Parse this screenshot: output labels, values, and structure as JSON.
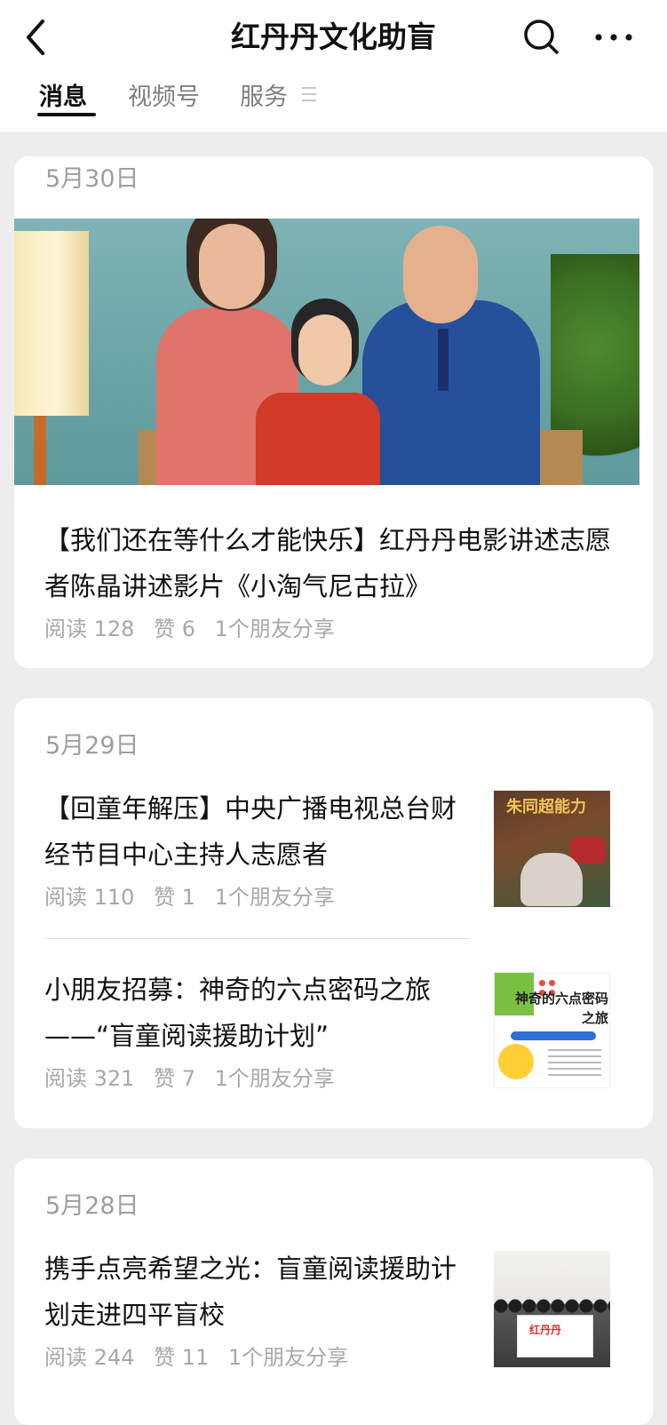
{
  "header": {
    "title": "红丹丹文化助盲",
    "back_icon": "chevron-left-icon",
    "search_icon": "search-icon",
    "more_icon": "more-horizontal-icon"
  },
  "tabs": [
    {
      "label": "消息",
      "active": true
    },
    {
      "label": "视频号",
      "active": false
    },
    {
      "label": "服务",
      "active": false
    }
  ],
  "feed": [
    {
      "date": "5月30日",
      "articles": [
        {
          "title": "【我们还在等什么才能快乐】红丹丹电影讲述志愿者陈晶讲述影片《小淘气尼古拉》",
          "reads": "阅读 128",
          "likes": "赞 6",
          "shares": "1个朋友分享",
          "image": "family-photo"
        }
      ]
    },
    {
      "date": "5月29日",
      "articles": [
        {
          "title": "【回童年解压】中央广播电视总台财经节目中心主持人志愿者",
          "reads": "阅读 110",
          "likes": "赞 1",
          "shares": "1个朋友分享",
          "thumb_text": "朱同超能力"
        },
        {
          "title": "小朋友招募：神奇的六点密码之旅——“盲童阅读援助计划”",
          "reads": "阅读 321",
          "likes": "赞 7",
          "shares": "1个朋友分享",
          "thumb_text": "神奇的六点密码之旅"
        }
      ]
    },
    {
      "date": "5月28日",
      "articles": [
        {
          "title": "携手点亮希望之光：盲童阅读援助计划走进四平盲校",
          "reads": "阅读 244",
          "likes": "赞 11",
          "shares": "1个朋友分享",
          "thumb_text": "红丹丹"
        }
      ]
    }
  ],
  "colors": {
    "background": "#ededed",
    "card": "#ffffff",
    "muted_text": "#9e9e9e",
    "primary_text": "#111111"
  }
}
